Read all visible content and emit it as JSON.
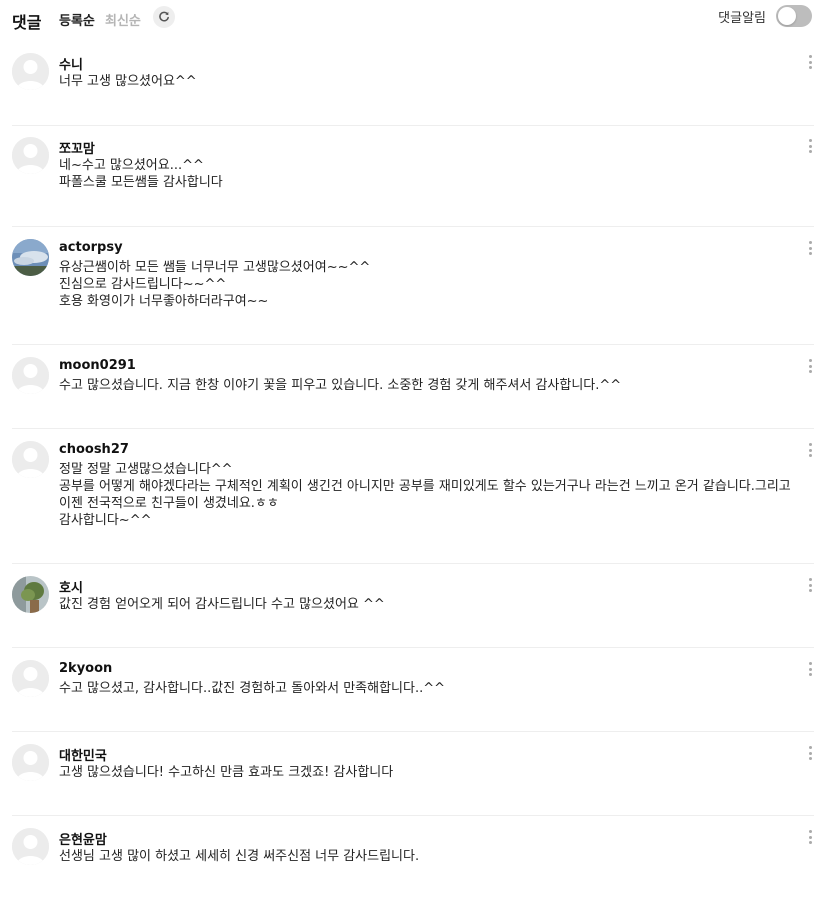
{
  "header": {
    "title": "댓글",
    "sort_registered": "등록순",
    "sort_latest": "최신순",
    "refresh_icon": "refresh-icon",
    "notify_label": "댓글알림",
    "notify_enabled": false
  },
  "comments": [
    {
      "author": "수니",
      "text": "너무 고생 많으셨어요^^",
      "avatar": "default-avatar-icon"
    },
    {
      "author": "쪼꼬맘",
      "text": "네~수고 많으셨어요...^^\n파폴스쿨 모든쌤들 감사합니다",
      "avatar": "default-avatar-icon"
    },
    {
      "author": "actorpsy",
      "text": "유상근쌤이하 모든 쌤들 너무너무 고생많으셨어여~~^^\n진심으로 감사드립니다~~^^\n호용 화영이가 너무좋아하더라구여~~",
      "avatar": "photo-avatar-sky"
    },
    {
      "author": "moon0291",
      "text": "수고 많으셨습니다. 지금 한창 이야기 꽃을 피우고 있습니다. 소중한 경험 갖게 해주셔서 감사합니다.^^",
      "avatar": "default-avatar-icon"
    },
    {
      "author": "choosh27",
      "text": "정말 정말 고생많으셨습니다^^\n공부를 어떻게 해야겠다라는 구체적인 계획이 생긴건 아니지만 공부를 재미있게도 할수 있는거구나 라는건 느끼고 온거 같습니다.그리고 이젠 전국적으로 친구들이 생겼네요.ㅎㅎ\n감사합니다~^^",
      "avatar": "default-avatar-icon"
    },
    {
      "author": "호시",
      "text": "값진 경험 얻어오게 되어 감사드립니다 수고 많으셨어요 ^^",
      "avatar": "photo-avatar-plant"
    },
    {
      "author": "2kyoon",
      "text": "수고 많으셨고, 감사합니다..값진 경험하고 돌아와서 만족해합니다..^^",
      "avatar": "default-avatar-icon"
    },
    {
      "author": "대한민국",
      "text": "고생 많으셨습니다! 수고하신 만큼 효과도 크겠죠! 감사합니다",
      "avatar": "default-avatar-icon"
    },
    {
      "author": "은현윤맘",
      "text": "선생님 고생 많이 하셨고 세세히 신경 써주신점 너무 감사드립니다.",
      "avatar": "default-avatar-icon"
    }
  ]
}
